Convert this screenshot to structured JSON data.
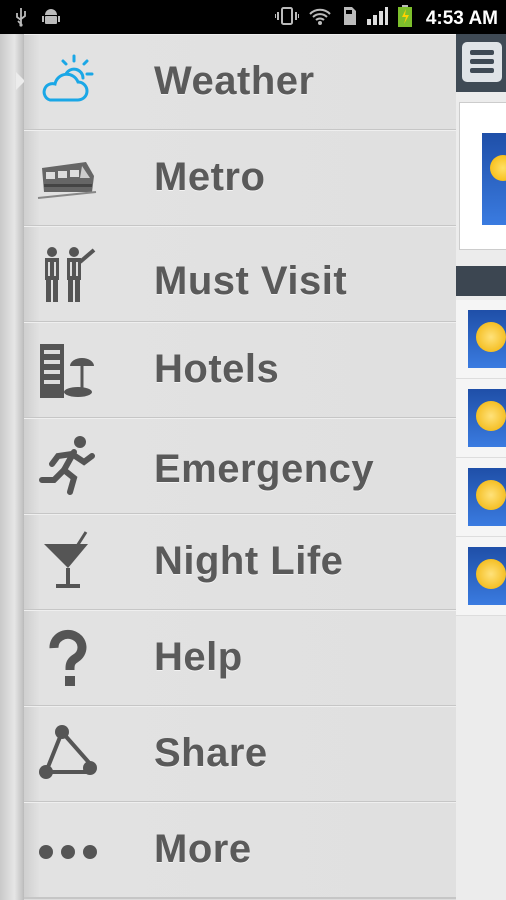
{
  "status_bar": {
    "time": "4:53 AM",
    "icons": [
      "usb-icon",
      "android-icon",
      "vibrate-icon",
      "wifi-icon",
      "sd-card-icon",
      "signal-icon",
      "battery-charging-icon"
    ]
  },
  "menu": {
    "items": [
      {
        "label": "Weather",
        "icon": "weather-cloud-sun-icon"
      },
      {
        "label": "Metro",
        "icon": "metro-train-icon"
      },
      {
        "label": "Must Visit",
        "icon": "sightseeing-people-icon"
      },
      {
        "label": "Hotels",
        "icon": "hotel-building-icon"
      },
      {
        "label": "Emergency",
        "icon": "running-man-icon"
      },
      {
        "label": "Night Life",
        "icon": "cocktail-glass-icon"
      },
      {
        "label": "Help",
        "icon": "question-mark-icon"
      },
      {
        "label": "Share",
        "icon": "share-icon"
      },
      {
        "label": "More",
        "icon": "more-dots-icon"
      }
    ]
  },
  "colors": {
    "accent_cyan": "#1aa7e6",
    "label_gray": "#5a5a5a",
    "icon_gray": "#555555",
    "right_header": "#3f4a55"
  }
}
